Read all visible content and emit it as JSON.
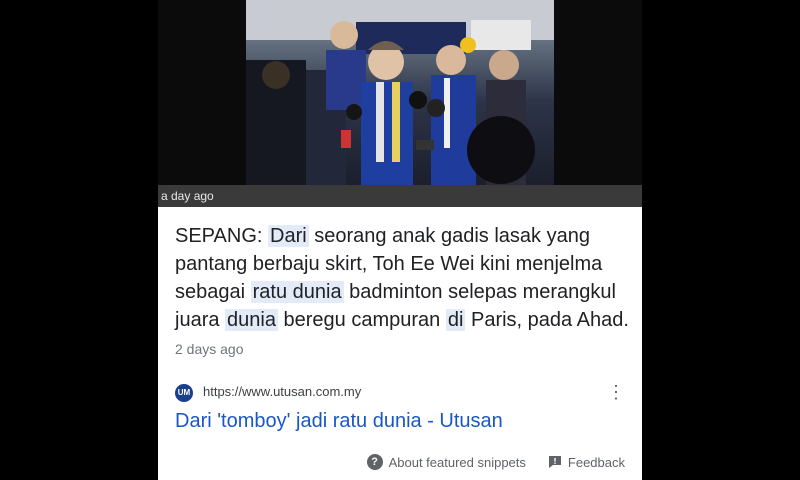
{
  "photo": {
    "caption_time": "a day ago"
  },
  "snippet": {
    "parts": {
      "p1": "SEPANG: ",
      "h1": "Dari",
      "p2": " seorang anak gadis lasak yang pantang berbaju skirt, Toh Ee Wei kini menjelma sebagai ",
      "h2": "ratu dunia",
      "p3": " badminton selepas merangkul juara ",
      "h3": "dunia",
      "p4": " beregu campuran ",
      "h4": "di",
      "p5": " Paris, pada Ahad."
    },
    "time_ago": "2 days ago"
  },
  "source": {
    "favicon_text": "UM",
    "url": "https://www.utusan.com.my",
    "more_icon": "vertical-dots-icon"
  },
  "result": {
    "title": "Dari 'tomboy' jadi ratu dunia - Utusan"
  },
  "footer": {
    "about_label": "About featured snippets",
    "feedback_label": "Feedback",
    "about_icon": "help-circle-icon",
    "feedback_icon": "feedback-icon"
  },
  "colors": {
    "background": "#000000",
    "highlight": "#e3ebf8",
    "link": "#1a57c6",
    "text": "#202124"
  }
}
